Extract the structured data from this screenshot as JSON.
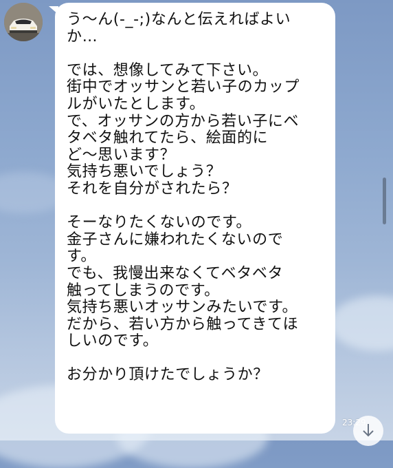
{
  "chat": {
    "message": {
      "lines": [
        "う～ん(-_-;)なんと伝えればよい",
        "か…",
        "",
        "では、想像してみて下さい。",
        "街中でオッサンと若い子のカップ",
        "ルがいたとします。",
        "で、オッサンの方から若い子にベ",
        "タベタ触れてたら、絵面的に",
        "ど～思います？",
        "気持ち悪いでしょう？",
        "それを自分がされたら？",
        "",
        "そーなりたくないのです。",
        "金子さんに嫌われたくないので",
        "す。",
        "でも、我慢出来なくてベタベタ",
        "触ってしまうのです。",
        "気持ち悪いオッサンみたいです。",
        "だから、若い方から触ってきてほ",
        "しいのです。",
        "",
        "お分かり頂けたでしょうか？"
      ],
      "time": "23:29"
    }
  },
  "colors": {
    "background": "#8ea9cf",
    "bubble": "#ffffff",
    "text": "#111111"
  },
  "icons": {
    "avatar": "car-photo-avatar",
    "scroll": "arrow-down-icon"
  }
}
